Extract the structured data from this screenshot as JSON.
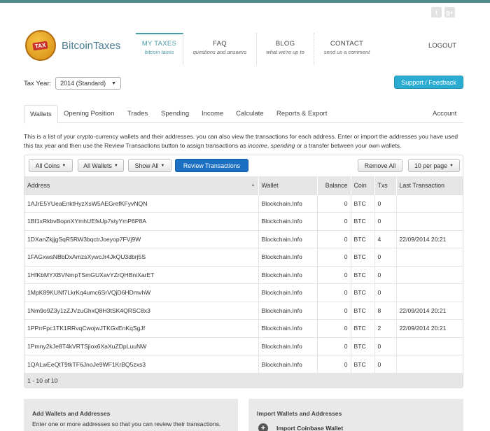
{
  "social": [
    "t",
    "g+"
  ],
  "brand": {
    "name": "BitcoinTaxes",
    "coin_label": "TAX"
  },
  "nav": [
    {
      "title": "MY TAXES",
      "sub": "bitcoin taxes"
    },
    {
      "title": "FAQ",
      "sub": "questions and answers"
    },
    {
      "title": "BLOG",
      "sub": "what we're up to"
    },
    {
      "title": "CONTACT",
      "sub": "send us a comment"
    }
  ],
  "logout": "LOGOUT",
  "tax_year": {
    "label": "Tax Year:",
    "value": "2014 (Standard)"
  },
  "support_button": "Support / Feedback",
  "tabs": [
    "Wallets",
    "Opening Position",
    "Trades",
    "Spending",
    "Income",
    "Calculate",
    "Reports & Export",
    "Account"
  ],
  "description": {
    "part1": "This is a list of your crypto-currency wallets and their addresses. you can also view the transactions for each address. Enter or import the addresses you have used this tax year and then use the Review Transactions button to assign transactions as ",
    "em1": "income",
    "part2": ", ",
    "em2": "spending",
    "part3": " or a transfer between your own wallets."
  },
  "toolbar": {
    "all_coins": "All Coins",
    "all_wallets": "All Wallets",
    "show_all": "Show All",
    "review": "Review Transactions",
    "remove_all": "Remove All",
    "per_page": "10 per page"
  },
  "table": {
    "headers": [
      "Address",
      "Wallet",
      "Balance",
      "Coin",
      "Txs",
      "Last Transaction"
    ],
    "rows": [
      [
        "1AJrE5YUeaEnktHyzXsW5AEGrefKFyvNQN",
        "Blockchain.Info",
        "0",
        "BTC",
        "0",
        ""
      ],
      [
        "1Bf1xRkbvBopnXYmhUEfsUp7styYmP6P8A",
        "Blockchain.Info",
        "0",
        "BTC",
        "0",
        ""
      ],
      [
        "1DXanZkjjgSqR5RW3bqctrJoeyop7FVj9W",
        "Blockchain.Info",
        "0",
        "BTC",
        "4",
        "22/09/2014 20:21"
      ],
      [
        "1FAGxwsNBbDxAmzsXywcJr4JkQU3dbrj5S",
        "Blockchain.Info",
        "0",
        "BTC",
        "0",
        ""
      ],
      [
        "1HfKbMYXBVNmpTSmGUXavYZrQHBniXarET",
        "Blockchain.Info",
        "0",
        "BTC",
        "0",
        ""
      ],
      [
        "1MpK89KUNf7LkrKq4umc6SrVQjD6HDmvhW",
        "Blockchain.Info",
        "0",
        "BTC",
        "0",
        ""
      ],
      [
        "1Nm9o9Z3y1zZJVzuGhxQ8H3tSK4QRSC8x3",
        "Blockchain.Info",
        "0",
        "BTC",
        "8",
        "22/09/2014 20:21"
      ],
      [
        "1PPrrFpc1TK1RRvqCwojwJTKGxEnKqSgJf",
        "Blockchain.Info",
        "0",
        "BTC",
        "2",
        "22/09/2014 20:21"
      ],
      [
        "1Pmny2kJe8T4kVRTSjiox6XaXuZDpLuuNW",
        "Blockchain.Info",
        "0",
        "BTC",
        "0",
        ""
      ],
      [
        "1QALwEeQtT9tkTF6JnoJe9WF1KrBQ5zxs3",
        "Blockchain.Info",
        "0",
        "BTC",
        "0",
        ""
      ]
    ],
    "footer": "1 - 10 of 10"
  },
  "add_box": {
    "title": "Add Wallets and Addresses",
    "text": "Enter one or more addresses so that you can review their transactions."
  },
  "import_box": {
    "title": "Import Wallets and Addresses",
    "item": "Import Coinbase Wallet"
  }
}
